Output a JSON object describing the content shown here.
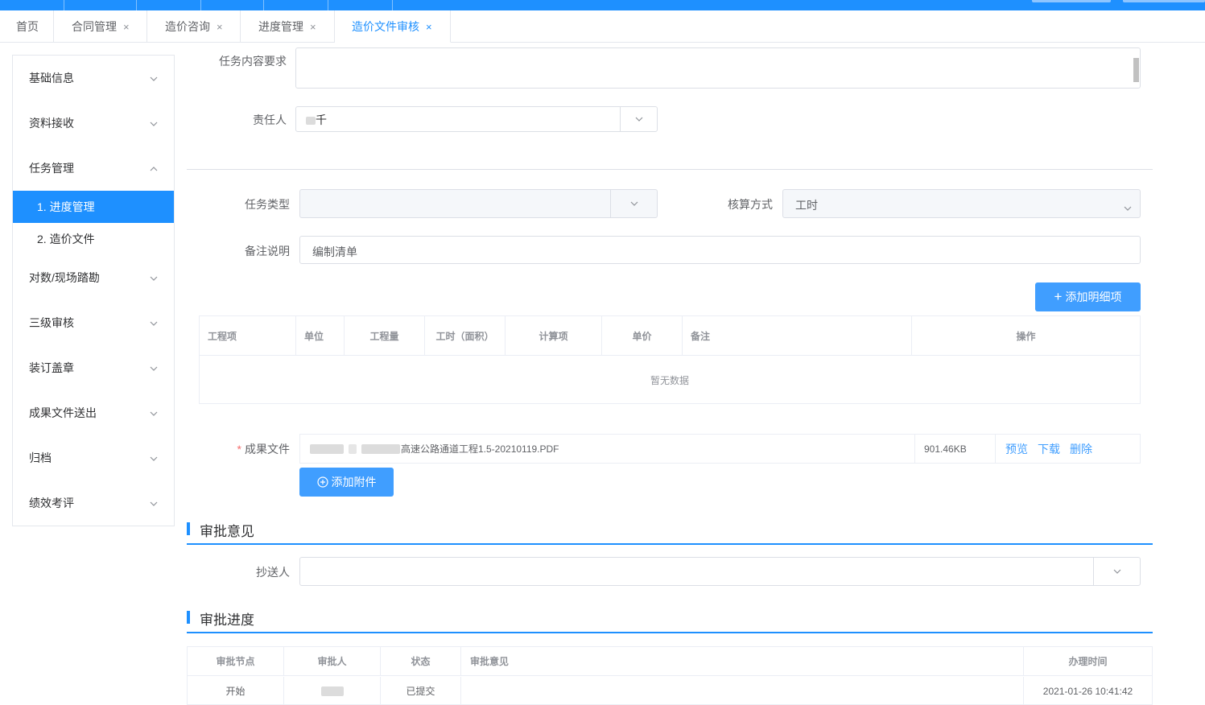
{
  "tabs": [
    {
      "label": "首页",
      "closable": false
    },
    {
      "label": "合同管理",
      "closable": true
    },
    {
      "label": "造价咨询",
      "closable": true
    },
    {
      "label": "进度管理",
      "closable": true
    },
    {
      "label": "造价文件审核",
      "closable": true,
      "active": true
    }
  ],
  "close_glyph": "×",
  "sidebar": {
    "items": [
      {
        "label": "基础信息",
        "icon": "chevron-down-icon"
      },
      {
        "label": "资料接收",
        "icon": "chevron-down-icon"
      },
      {
        "label": "任务管理",
        "icon": "chevron-up-icon"
      },
      {
        "label": "1. 进度管理",
        "active": true
      },
      {
        "label": "2. 造价文件"
      },
      {
        "label": "对数/现场踏勘",
        "icon": "chevron-down-icon"
      },
      {
        "label": "三级审核",
        "icon": "chevron-down-icon"
      },
      {
        "label": "装订盖章",
        "icon": "chevron-down-icon"
      },
      {
        "label": "成果文件送出",
        "icon": "chevron-down-icon"
      },
      {
        "label": "归档",
        "icon": "chevron-down-icon"
      },
      {
        "label": "绩效考评",
        "icon": "chevron-down-icon"
      }
    ]
  },
  "form": {
    "task_req_label": "任务内容要求",
    "task_req_value": "",
    "owner_label": "责任人",
    "owner_value": "千",
    "task_type_label": "任务类型",
    "task_type_value": "",
    "calc_label": "核算方式",
    "calc_value": "工时",
    "remark_label": "备注说明",
    "remark_value": "编制清单",
    "add_detail_button": "添加明细项",
    "plus_glyph": "+"
  },
  "detail_table": {
    "headers": [
      "工程项",
      "单位",
      "工程量",
      "工时（面积）",
      "计算项",
      "单价",
      "备注",
      "操作"
    ],
    "empty_text": "暂无数据"
  },
  "attachment": {
    "required_mark": "*",
    "label": "成果文件",
    "filename": "高速公路通道工程1.5-20210119.PDF",
    "size": "901.46KB",
    "actions": [
      "预览",
      "下载",
      "删除"
    ],
    "add_button": "添加附件"
  },
  "approval_opinion": {
    "title": "审批意见",
    "cc_label": "抄送人",
    "cc_value": ""
  },
  "approval_progress": {
    "title": "审批进度",
    "headers": [
      "审批节点",
      "审批人",
      "状态",
      "审批意见",
      "办理时间"
    ],
    "rows": [
      {
        "node": "开始",
        "approver": "",
        "status": "已提交",
        "opinion": "",
        "time": "2021-01-26 10:41:42"
      }
    ]
  },
  "colors": {
    "accent": "#1e90ff",
    "button": "#409eff",
    "required": "#f56c6c"
  }
}
